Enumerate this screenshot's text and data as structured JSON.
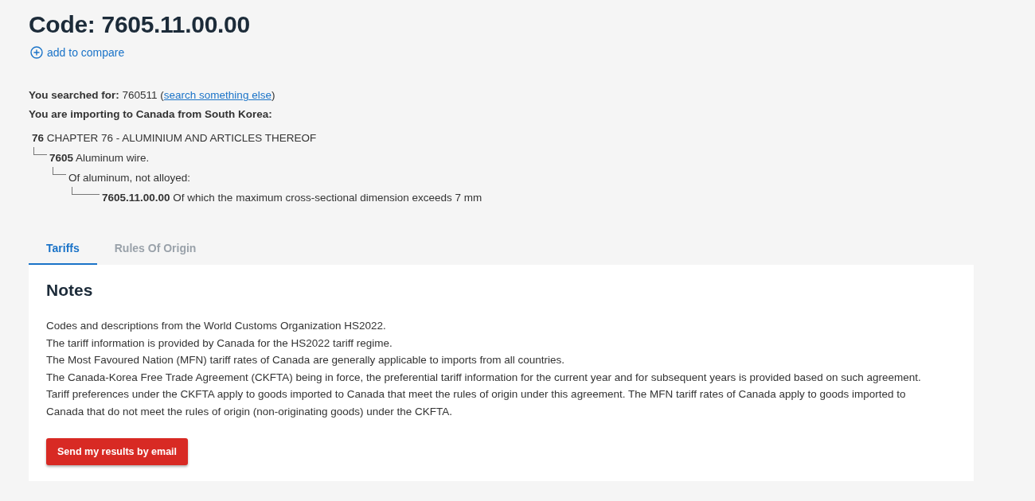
{
  "heading": "Code: 7605.11.00.00",
  "compare_link": "add to compare",
  "search": {
    "before": "**You searched for:** 760511 (",
    "link": "search something else",
    "after": ")"
  },
  "importing": "You are importing to Canada from South Korea:",
  "tree": [
    {
      "code": "76",
      "text": "CHAPTER 76 - ALUMINIUM AND ARTICLES THEREOF",
      "children": [
        {
          "code": "7605",
          "text": "Aluminum wire.",
          "children": [
            {
              "text": "Of aluminum, not alloyed:",
              "children": [
                {
                  "code": "7605.11.00.00",
                  "text": "Of which the maximum cross-sectional dimension exceeds 7 mm"
                }
              ]
            }
          ]
        }
      ]
    }
  ],
  "tabs": [
    {
      "label": "Tariffs",
      "selected": true
    },
    {
      "label": "Rules Of Origin",
      "selected": false
    }
  ],
  "notes": {
    "title": "Notes",
    "paragraphs": [
      "Codes and descriptions from the World Customs Organization HS2022.",
      "The tariff information is provided by Canada for the HS2022 tariff regime.",
      "The Most Favoured Nation (MFN) tariff rates of Canada are generally applicable to imports from all countries.",
      "The Canada-Korea Free Trade Agreement (CKFTA) being in force, the preferential tariff information for the current year and for subsequent years is provided based on such agreement. Tariff preferences under the CKFTA apply to goods imported to Canada that meet the rules of origin under this agreement. The MFN tariff rates of Canada apply to goods imported to Canada that do not meet the rules of origin (non-originating goods) under the CKFTA."
    ],
    "button": "Send my results by email"
  }
}
